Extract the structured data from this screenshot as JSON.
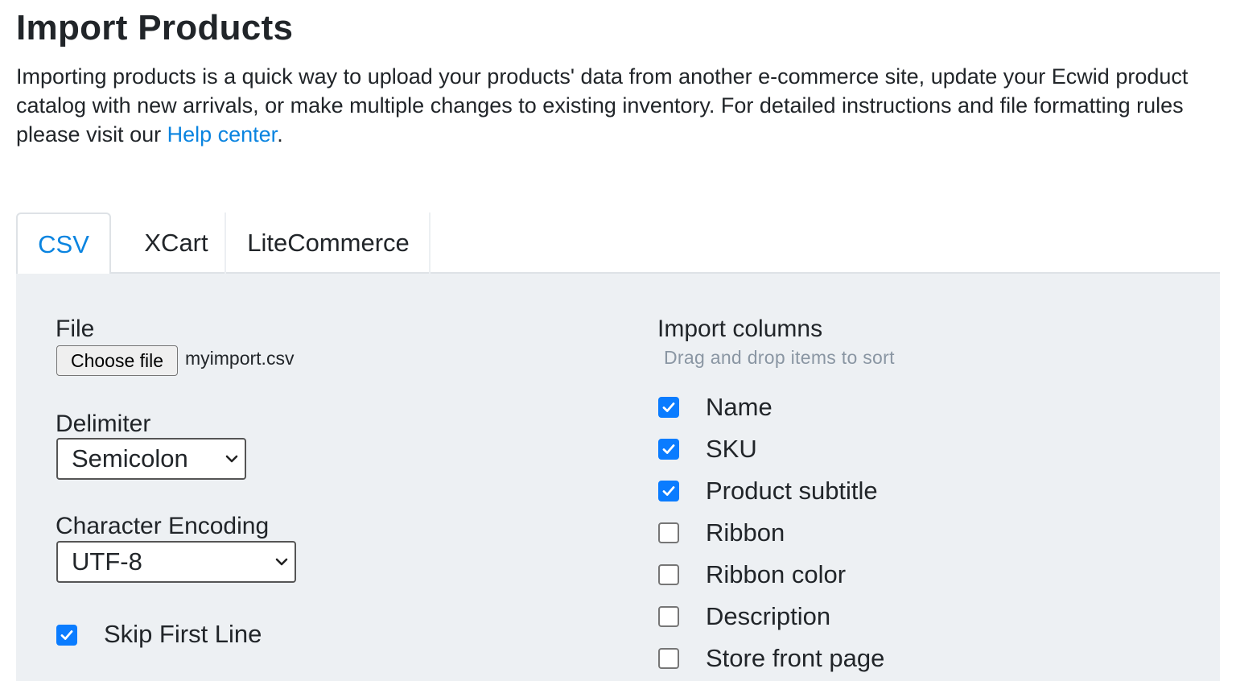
{
  "page": {
    "title": "Import Products",
    "intro_text": "Importing products is a quick way to upload your products' data from another e-commerce site, update your Ecwid product catalog with new arrivals, or make multiple changes to existing inventory. For detailed instructions and file formatting rules please visit our ",
    "help_link": "Help center",
    "intro_end": "."
  },
  "tabs": [
    {
      "label": "CSV",
      "active": true
    },
    {
      "label": "XCart",
      "active": false
    },
    {
      "label": "LiteCommerce",
      "active": false
    }
  ],
  "form": {
    "file_label": "File",
    "choose_file_label": "Choose file",
    "file_name": "myimport.csv",
    "delimiter_label": "Delimiter",
    "delimiter_value": "Semicolon",
    "encoding_label": "Character Encoding",
    "encoding_value": "UTF-8",
    "skip_first_line_label": "Skip First Line",
    "skip_first_line_checked": true
  },
  "columns": {
    "title": "Import columns",
    "hint": "Drag and drop items to sort",
    "items": [
      {
        "label": "Name",
        "checked": true
      },
      {
        "label": "SKU",
        "checked": true
      },
      {
        "label": "Product subtitle",
        "checked": true
      },
      {
        "label": "Ribbon",
        "checked": false
      },
      {
        "label": "Ribbon color",
        "checked": false
      },
      {
        "label": "Description",
        "checked": false
      },
      {
        "label": "Store front page",
        "checked": false
      }
    ]
  },
  "colors": {
    "link": "#0a84e0",
    "checkbox_checked": "#0a7cff",
    "panel_bg": "#edf0f3",
    "hint": "#8a96a3"
  },
  "icons": {
    "checkmark": "checkmark-icon",
    "select_arrow": "chevron-down-icon"
  }
}
